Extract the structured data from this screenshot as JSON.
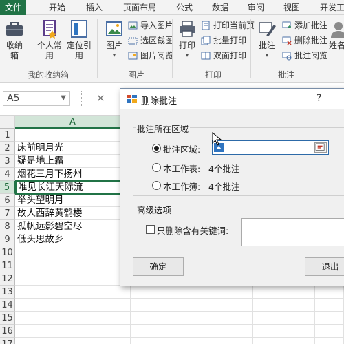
{
  "ribbon_tabs": [
    "文件",
    "开始",
    "插入",
    "页面布局",
    "公式",
    "数据",
    "审阅",
    "视图",
    "开发工"
  ],
  "ribbon": {
    "favorites": {
      "btn1": "收纳箱",
      "btn2": "个人常用",
      "btn3": "定位引用",
      "label": "我的收纳箱"
    },
    "pictures": {
      "big": "图片",
      "small": [
        "导入图片",
        "选区截图",
        "图片阅览"
      ],
      "label": "图片"
    },
    "print": {
      "big": "打印",
      "small": [
        "打印当前页",
        "批量打印",
        "双面打印"
      ],
      "label": "打印"
    },
    "comments": {
      "big": "批注",
      "small": [
        "添加批注",
        "删除批注",
        "批注阅览"
      ],
      "label": "批注"
    },
    "partial": "姓名"
  },
  "formula_bar": {
    "name_box": "A5",
    "cancel_symbol": "✕"
  },
  "sheet": {
    "column_headers": [
      "A"
    ],
    "row_numbers": [
      "1",
      "2",
      "3",
      "4",
      "5",
      "6",
      "7",
      "8",
      "9",
      "10",
      "11",
      "12",
      "13",
      "14",
      "15",
      "16",
      "17"
    ],
    "rows": [
      {
        "r": "1",
        "a": ""
      },
      {
        "r": "2",
        "a": "床前明月光"
      },
      {
        "r": "3",
        "a": "疑是地上霜"
      },
      {
        "r": "4",
        "a": "烟花三月下扬州"
      },
      {
        "r": "5",
        "a": "唯见长江天际流"
      },
      {
        "r": "6",
        "a": "举头望明月"
      },
      {
        "r": "7",
        "a": "故人西辞黄鹤楼"
      },
      {
        "r": "8",
        "a": "孤帆远影碧空尽"
      },
      {
        "r": "9",
        "a": "低头思故乡"
      }
    ],
    "active_cell": "A5"
  },
  "dialog": {
    "title": "删除批注",
    "help": "?",
    "region_group": "批注所在区域",
    "option_range": "批注区域:",
    "option_sheet": "本工作表:",
    "sheet_count": "4个批注",
    "option_book": "本工作簿:",
    "book_count": "4个批注",
    "advanced_group": "高级选项",
    "keyword_only": "只删除含有关键词:",
    "ok": "确定",
    "cancel": "退出"
  },
  "colors": {
    "excel_green": "#217346",
    "selection": "#d2e5d8",
    "focus_blue": "#2d6aa8"
  }
}
